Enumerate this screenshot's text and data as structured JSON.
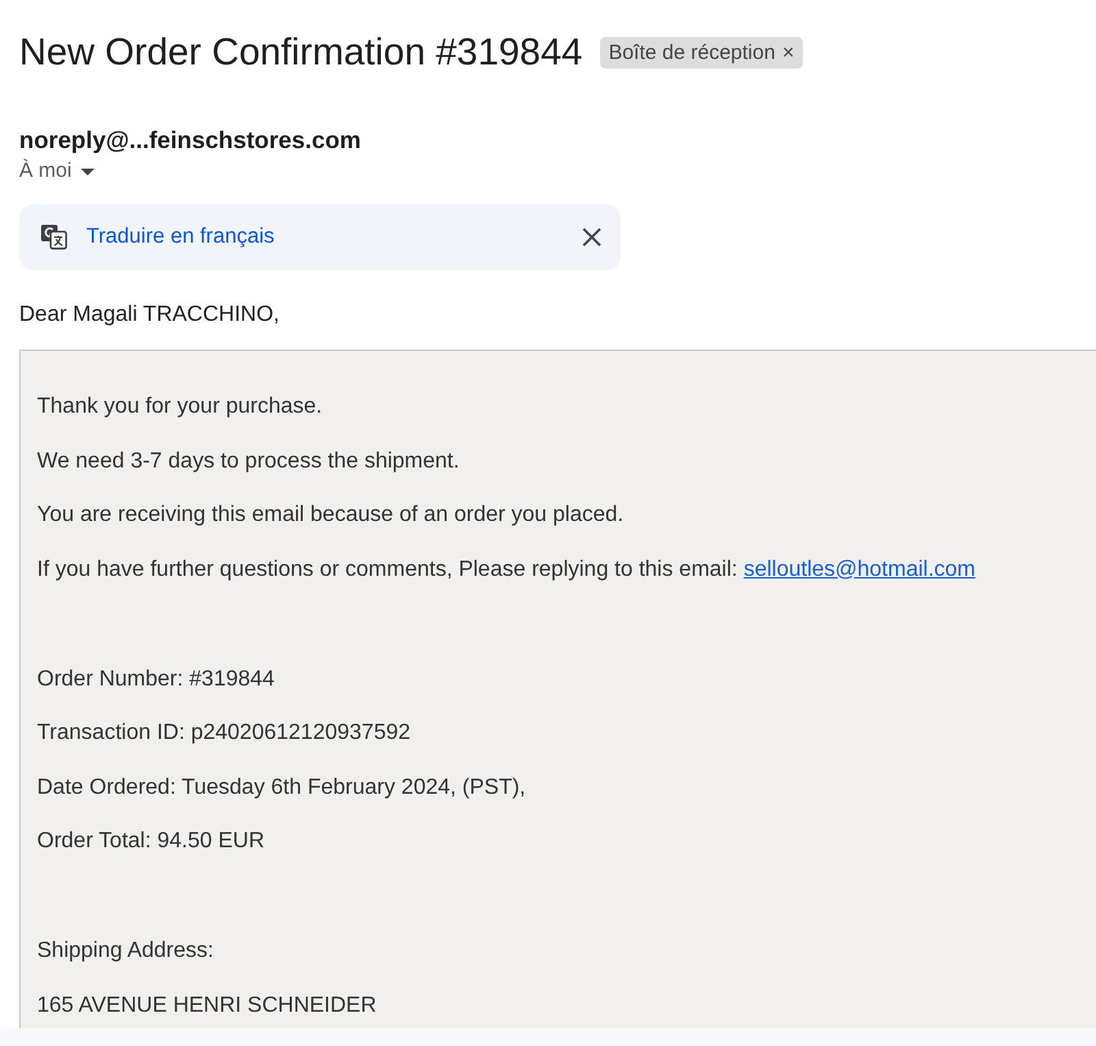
{
  "subject": {
    "title": "New Order Confirmation #319844",
    "label": {
      "text": "Boîte de réception",
      "remove": "×"
    }
  },
  "sender": {
    "address": "noreply@...feinschstores.com",
    "recipient": "À moi"
  },
  "translate_banner": {
    "action": "Traduire en français"
  },
  "greeting": "Dear Magali TRACCHINO,",
  "message_box": {
    "sections": [
      {
        "paragraphs": [
          {
            "kind": "text",
            "text": "Thank you for your purchase."
          },
          {
            "kind": "text",
            "text": "We need 3-7 days to process the shipment."
          },
          {
            "kind": "text",
            "text": "You are receiving this email because of an order you placed."
          },
          {
            "kind": "link",
            "text": "If you have further questions or comments, Please replying to this email:",
            "link": "selloutles@hotmail.com"
          }
        ]
      },
      {
        "paragraphs": [
          {
            "kind": "text",
            "text": "Order Number: #319844"
          },
          {
            "kind": "text",
            "text": "Transaction ID: p24020612120937592"
          },
          {
            "kind": "text",
            "text": "Date Ordered: Tuesday 6th February 2024, (PST),"
          },
          {
            "kind": "text",
            "text": "Order Total: 94.50 EUR"
          }
        ]
      },
      {
        "paragraphs": [
          {
            "kind": "text",
            "text": "Shipping Address:"
          },
          {
            "kind": "text",
            "text": "165 AVENUE HENRI SCHNEIDER"
          }
        ]
      }
    ]
  }
}
